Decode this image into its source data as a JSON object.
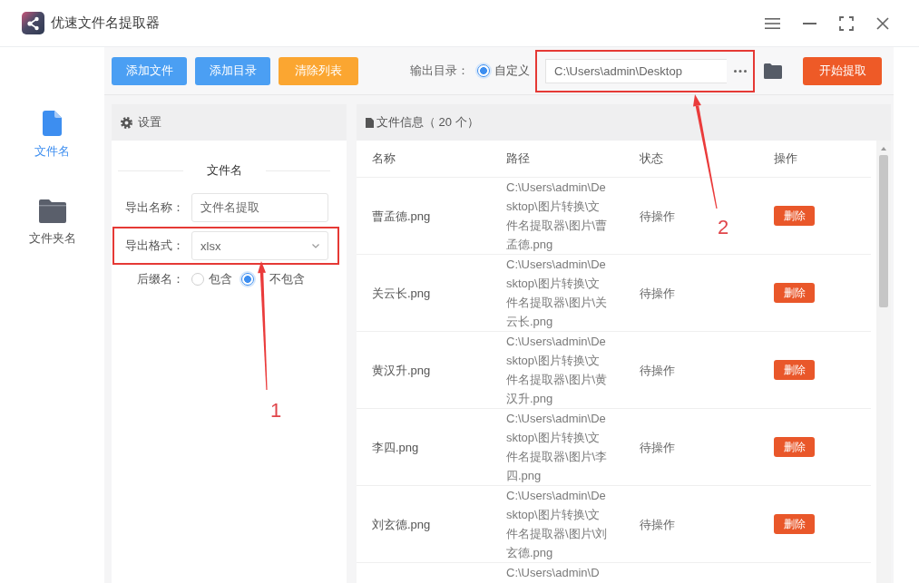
{
  "window": {
    "title": "优速文件名提取器"
  },
  "sidebar": {
    "items": [
      {
        "label": "文件名",
        "kind": "file",
        "selected": true
      },
      {
        "label": "文件夹名",
        "kind": "folder",
        "selected": false
      }
    ]
  },
  "toolbar": {
    "buttons": [
      {
        "label": "添加文件",
        "kind": "primary"
      },
      {
        "label": "添加目录",
        "kind": "primary"
      },
      {
        "label": "清除列表",
        "kind": "warning"
      }
    ],
    "output_label": "输出目录：",
    "output_option": {
      "label": "自定义",
      "selected": true
    },
    "output_path": "C:\\Users\\admin\\Desktop",
    "path_highlighted": true,
    "start_button": "开始提取"
  },
  "settings": {
    "title": "设置",
    "section": "文件名",
    "fields": [
      {
        "label": "导出名称：",
        "kind": "input",
        "value": "文件名提取",
        "highlighted": false
      },
      {
        "label": "导出格式：",
        "kind": "select",
        "value": "xlsx",
        "highlighted": true
      }
    ],
    "suffix": {
      "label": "后缀名：",
      "options": [
        {
          "label": "包含",
          "selected": false
        },
        {
          "label": "不包含",
          "selected": true
        }
      ]
    }
  },
  "file_list": {
    "title": "文件信息（ 20 个）",
    "columns": [
      "名称",
      "路径",
      "状态",
      "操作"
    ],
    "rows": [
      {
        "name": "曹孟德.png",
        "path": "C:\\Users\\admin\\Desktop\\图片转换\\文件名提取器\\图片\\曹孟德.png",
        "status": "待操作",
        "action": "删除"
      },
      {
        "name": "关云长.png",
        "path": "C:\\Users\\admin\\Desktop\\图片转换\\文件名提取器\\图片\\关云长.png",
        "status": "待操作",
        "action": "删除"
      },
      {
        "name": "黄汉升.png",
        "path": "C:\\Users\\admin\\Desktop\\图片转换\\文件名提取器\\图片\\黄汉升.png",
        "status": "待操作",
        "action": "删除"
      },
      {
        "name": "李四.png",
        "path": "C:\\Users\\admin\\Desktop\\图片转换\\文件名提取器\\图片\\李四.png",
        "status": "待操作",
        "action": "删除"
      },
      {
        "name": "刘玄德.png",
        "path": "C:\\Users\\admin\\Desktop\\图片转换\\文件名提取器\\图片\\刘玄德.png",
        "status": "待操作",
        "action": "删除"
      },
      {
        "path": "C:\\Users\\admin\\D"
      }
    ]
  },
  "annotations": [
    {
      "label": "1"
    },
    {
      "label": "2"
    }
  ]
}
